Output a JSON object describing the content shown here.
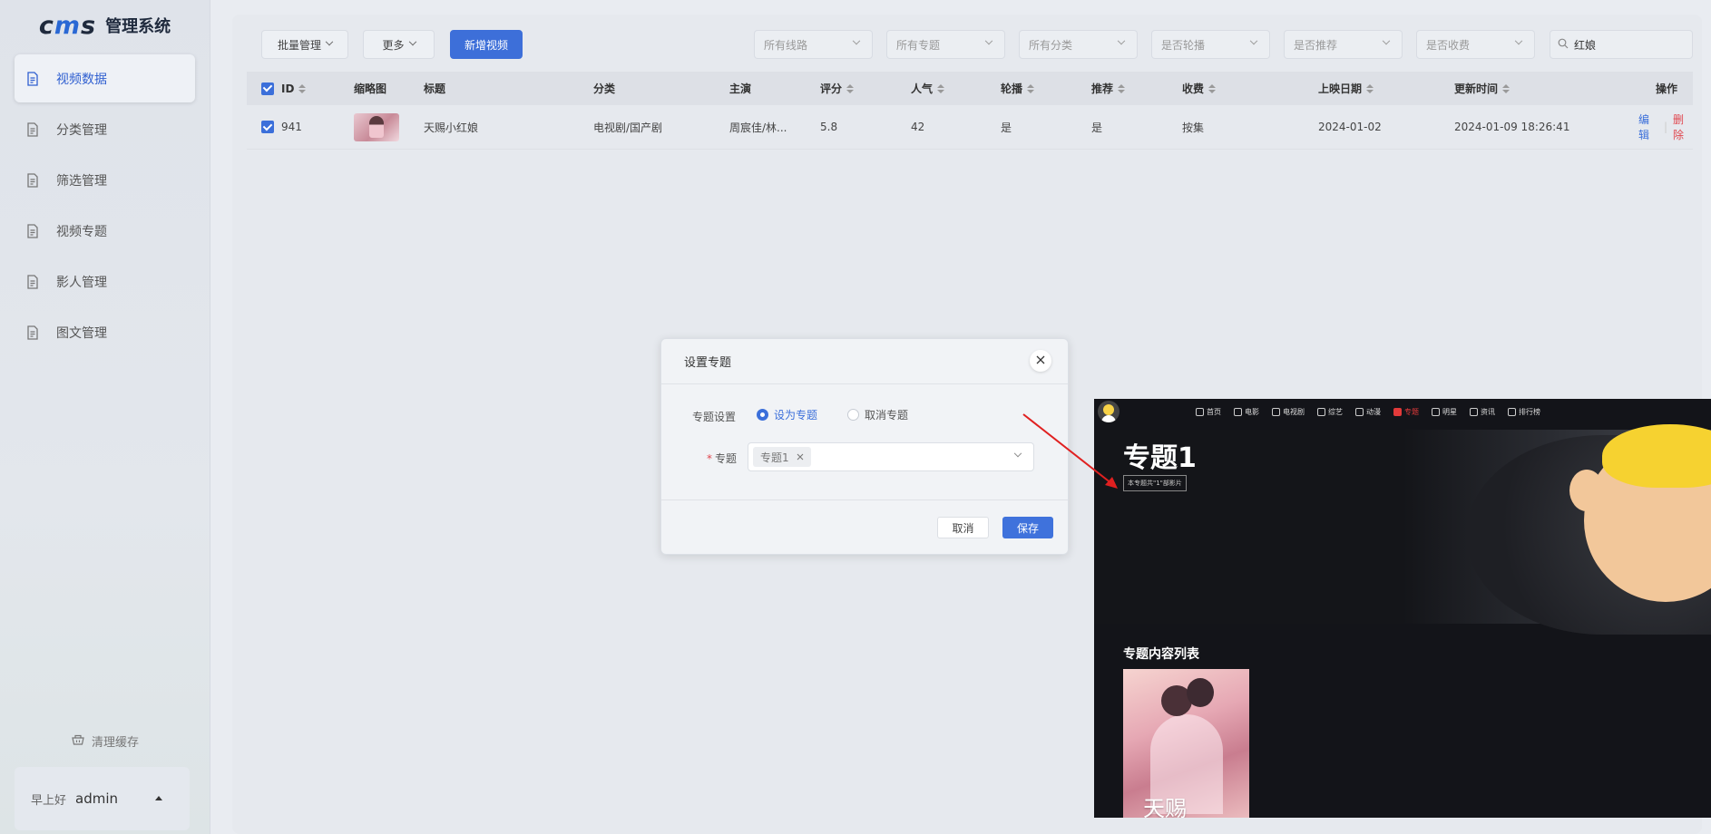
{
  "app": {
    "logo": "cms",
    "title": "管理系统"
  },
  "sidebar": {
    "items": [
      {
        "label": "视频数据",
        "active": true
      },
      {
        "label": "分类管理"
      },
      {
        "label": "筛选管理"
      },
      {
        "label": "视频专题"
      },
      {
        "label": "影人管理"
      },
      {
        "label": "图文管理"
      }
    ],
    "clear_cache": "清理缓存",
    "greeting": "早上好",
    "username": "admin"
  },
  "toolbar": {
    "batch_label": "批量管理",
    "more_label": "更多",
    "add_label": "新增视频",
    "filters": [
      "所有线路",
      "所有专题",
      "所有分类",
      "是否轮播",
      "是否推荐",
      "是否收费"
    ],
    "search_value": "红娘"
  },
  "table": {
    "headers": {
      "id": "ID",
      "thumb": "缩略图",
      "title": "标题",
      "category": "分类",
      "actor": "主演",
      "score": "评分",
      "popularity": "人气",
      "carousel": "轮播",
      "recommend": "推荐",
      "fee": "收费",
      "release": "上映日期",
      "updated": "更新时间",
      "ops": "操作"
    },
    "rows": [
      {
        "id": "941",
        "title": "天赐小红娘",
        "category": "电视剧/国产剧",
        "actor": "周宸佳/林...",
        "score": "5.8",
        "popularity": "42",
        "carousel": "是",
        "recommend": "是",
        "fee": "按集",
        "release": "2024-01-02",
        "updated": "2024-01-09 18:26:41",
        "edit": "编辑",
        "delete": "删除"
      }
    ]
  },
  "dialog": {
    "title": "设置专题",
    "setting_label": "专题设置",
    "option_set": "设为专题",
    "option_cancel": "取消专题",
    "topic_label": "专题",
    "topic_tag": "专题1",
    "cancel_btn": "取消",
    "save_btn": "保存"
  },
  "preview": {
    "nav": [
      "首页",
      "电影",
      "电视剧",
      "综艺",
      "动漫",
      "专题",
      "明星",
      "资讯",
      "排行榜"
    ],
    "active_nav": "专题",
    "title": "专题1",
    "badge": "本专题共\"1\"部影片",
    "list_title": "专题内容列表",
    "poster_text": "天赐"
  },
  "colors": {
    "primary": "#3d6fd9",
    "danger": "#e0474f",
    "preview_bg": "#131419",
    "arrow": "#e02020"
  }
}
